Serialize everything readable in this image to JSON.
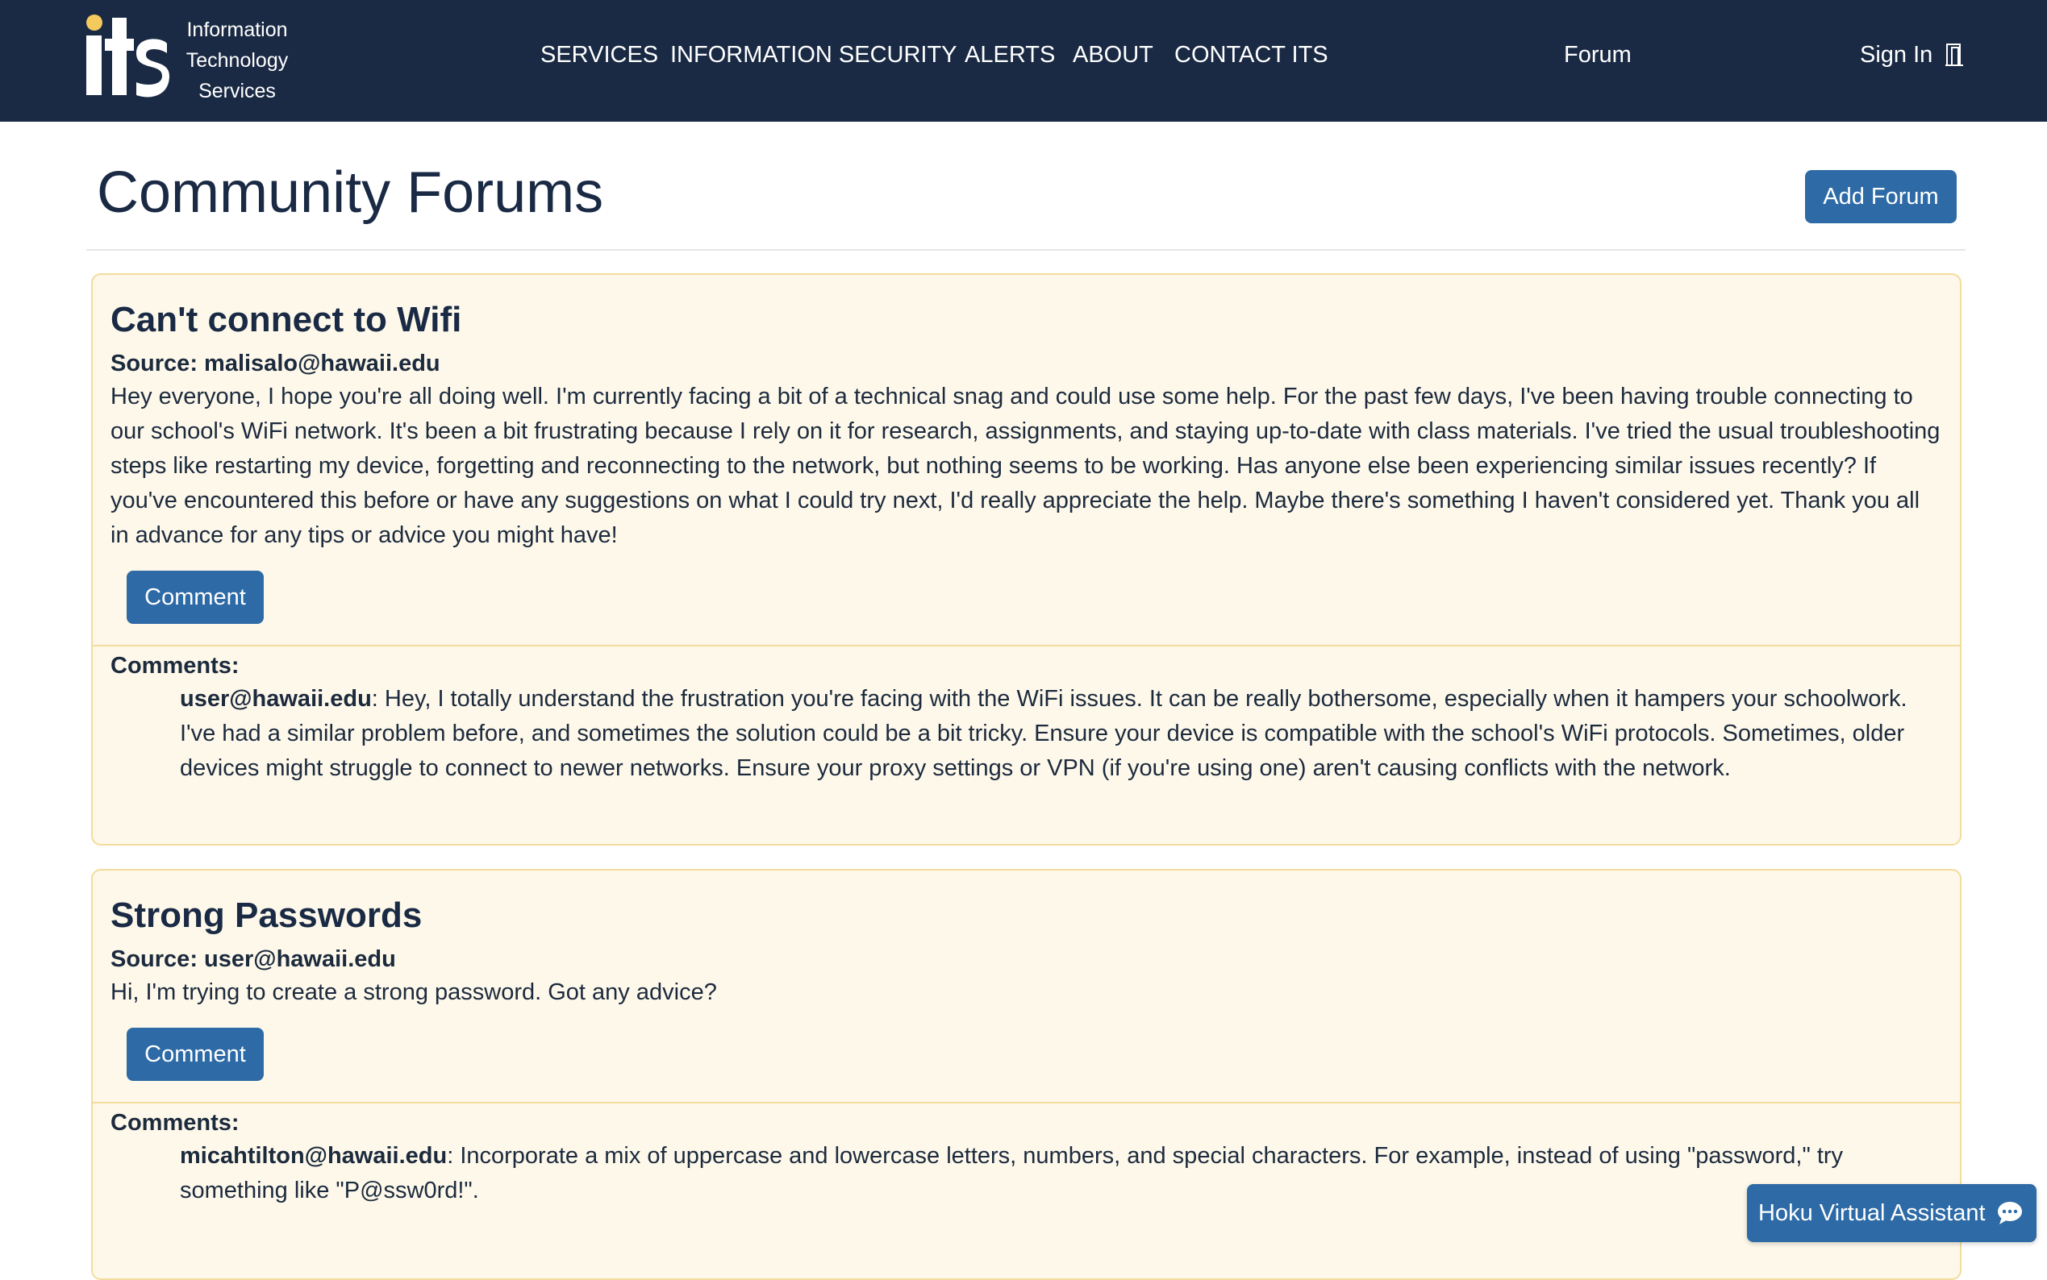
{
  "header": {
    "logo_letters": "its",
    "logo_lines": [
      "Information",
      "Technology",
      "Services"
    ],
    "nav": [
      "SERVICES",
      "INFORMATION SECURITY",
      "ALERTS",
      "ABOUT",
      "CONTACT ITS"
    ],
    "forum_link": "Forum",
    "sign_in": "Sign In",
    "logo_dot_color": "#f4c95d",
    "nav_bg": "#1a2a44"
  },
  "main": {
    "title": "Community Forums",
    "add_button": "Add Forum"
  },
  "posts": [
    {
      "title": "Can't connect to Wifi",
      "source": "Source: malisalo@hawaii.edu",
      "text": "Hey everyone, I hope you're all doing well. I'm currently facing a bit of a technical snag and could use some help. For the past few days, I've been having trouble connecting to our school's WiFi network. It's been a bit frustrating because I rely on it for research, assignments, and staying up-to-date with class materials. I've tried the usual troubleshooting steps like restarting my device, forgetting and reconnecting to the network, but nothing seems to be working. Has anyone else been experiencing similar issues recently? If you've encountered this before or have any suggestions on what I could try next, I'd really appreciate the help. Maybe there's something I haven't considered yet. Thank you all in advance for any tips or advice you might have!",
      "comment_button": "Comment",
      "comments_label": "Comments:",
      "comments": [
        {
          "author": "user@hawaii.edu",
          "text": ": Hey, I totally understand the frustration you're facing with the WiFi issues. It can be really bothersome, especially when it hampers your schoolwork. I've had a similar problem before, and sometimes the solution could be a bit tricky. Ensure your device is compatible with the school's WiFi protocols. Sometimes, older devices might struggle to connect to newer networks. Ensure your proxy settings or VPN (if you're using one) aren't causing conflicts with the network."
        }
      ]
    },
    {
      "title": "Strong Passwords",
      "source": "Source: user@hawaii.edu",
      "text": "Hi, I'm trying to create a strong password. Got any advice?",
      "comment_button": "Comment",
      "comments_label": "Comments:",
      "comments": [
        {
          "author": "micahtilton@hawaii.edu",
          "text": ": Incorporate a mix of uppercase and lowercase letters, numbers, and special characters. For example, instead of using \"password,\" try something like \"P@ssw0rd!\"."
        }
      ]
    }
  ],
  "assistant": {
    "label": "Hoku Virtual Assistant",
    "icon": "chat-bubble-icon"
  },
  "colors": {
    "accent": "#2d6aa6",
    "card_bg": "#fdf8ea",
    "card_border": "#f3dc9c"
  }
}
